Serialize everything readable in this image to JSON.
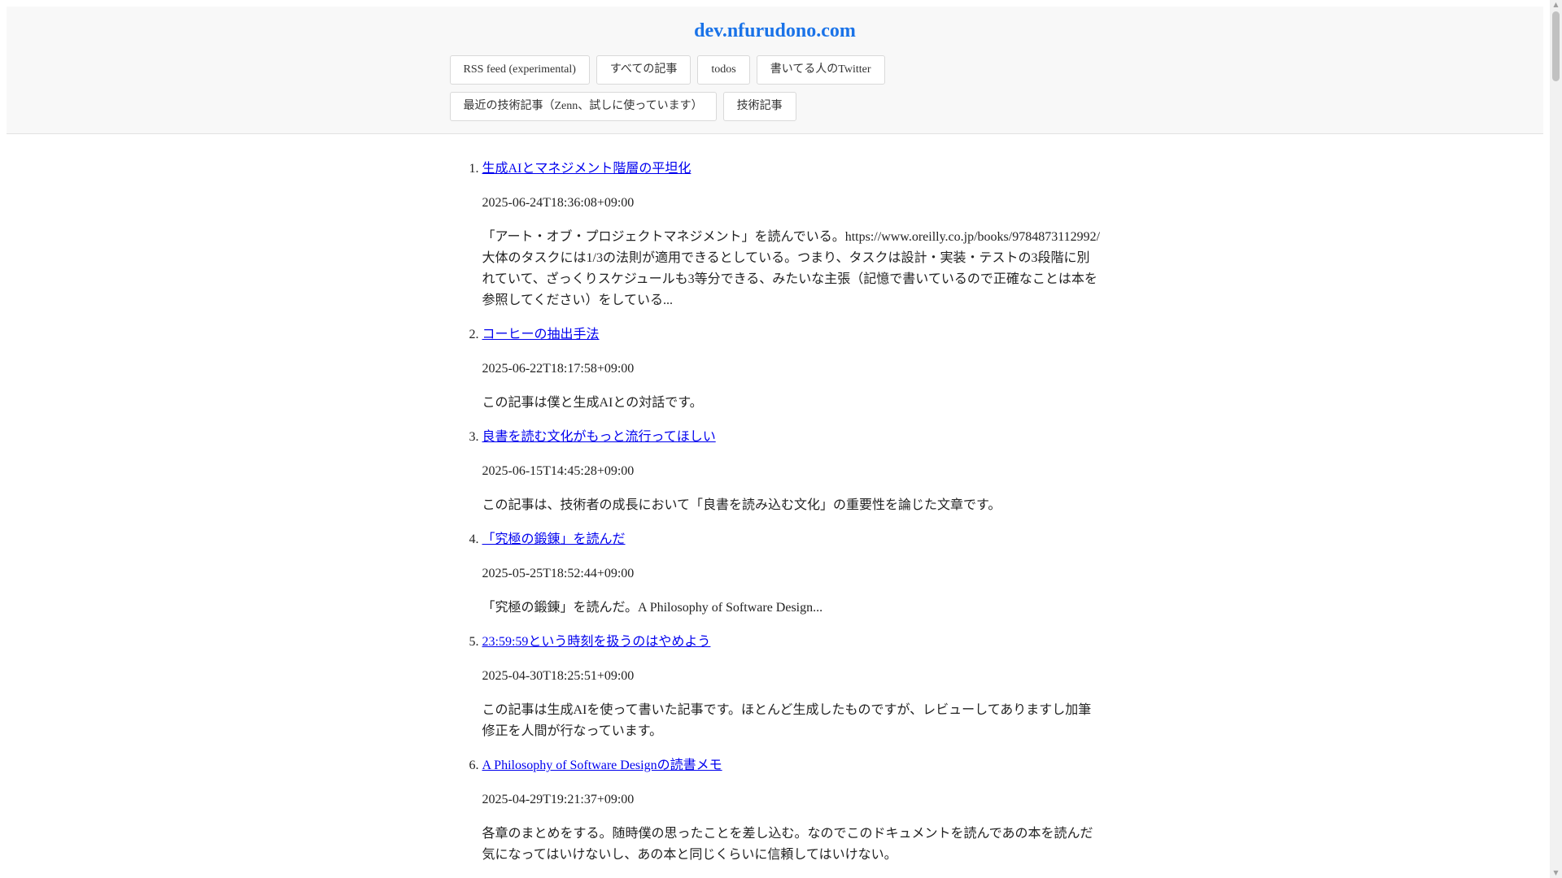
{
  "site": {
    "title": "dev.nfurudono.com"
  },
  "nav": {
    "row1": [
      {
        "label": "RSS feed (experimental)"
      },
      {
        "label": "すべての記事"
      },
      {
        "label": "todos"
      },
      {
        "label": "書いてる人のTwitter"
      }
    ],
    "row2": [
      {
        "label": "最近の技術記事（Zenn、試しに使っています）"
      },
      {
        "label": "技術記事"
      }
    ]
  },
  "posts": [
    {
      "title": "生成AIとマネジメント階層の平坦化",
      "date": "2025-06-24T18:36:08+09:00",
      "summary": "「アート・オブ・プロジェクトマネジメント」を読んでいる。https://www.oreilly.co.jp/books/9784873112992/大体のタスクには1/3の法則が適用できるとしている。つまり、タスクは設計・実装・テストの3段階に別れていて、ざっくりスケジュールも3等分できる、みたいな主張（記憶で書いているので正確なことは本を参照してください）をしている..."
    },
    {
      "title": "コーヒーの抽出手法",
      "date": "2025-06-22T18:17:58+09:00",
      "summary": "この記事は僕と生成AIとの対話です。"
    },
    {
      "title": "良書を読む文化がもっと流行ってほしい",
      "date": "2025-06-15T14:45:28+09:00",
      "summary": "この記事は、技術者の成長において「良書を読み込む文化」の重要性を論じた文章です。"
    },
    {
      "title": "「究極の鍛錬」を読んだ",
      "date": "2025-05-25T18:52:44+09:00",
      "summary": "「究極の鍛錬」を読んだ。A Philosophy of Software Design..."
    },
    {
      "title": "23:59:59という時刻を扱うのはやめよう",
      "date": "2025-04-30T18:25:51+09:00",
      "summary": "この記事は生成AIを使って書いた記事です。ほとんど生成したものですが、レビューしてありますし加筆修正を人間が行なっています。"
    },
    {
      "title": "A Philosophy of Software Designの読書メモ",
      "date": "2025-04-29T19:21:37+09:00",
      "summary": "各章のまとめをする。随時僕の思ったことを差し込む。なのでこのドキュメントを読んであの本を読んだ気になってはいけないし、あの本と同じくらいに信頼してはいけない。"
    }
  ]
}
